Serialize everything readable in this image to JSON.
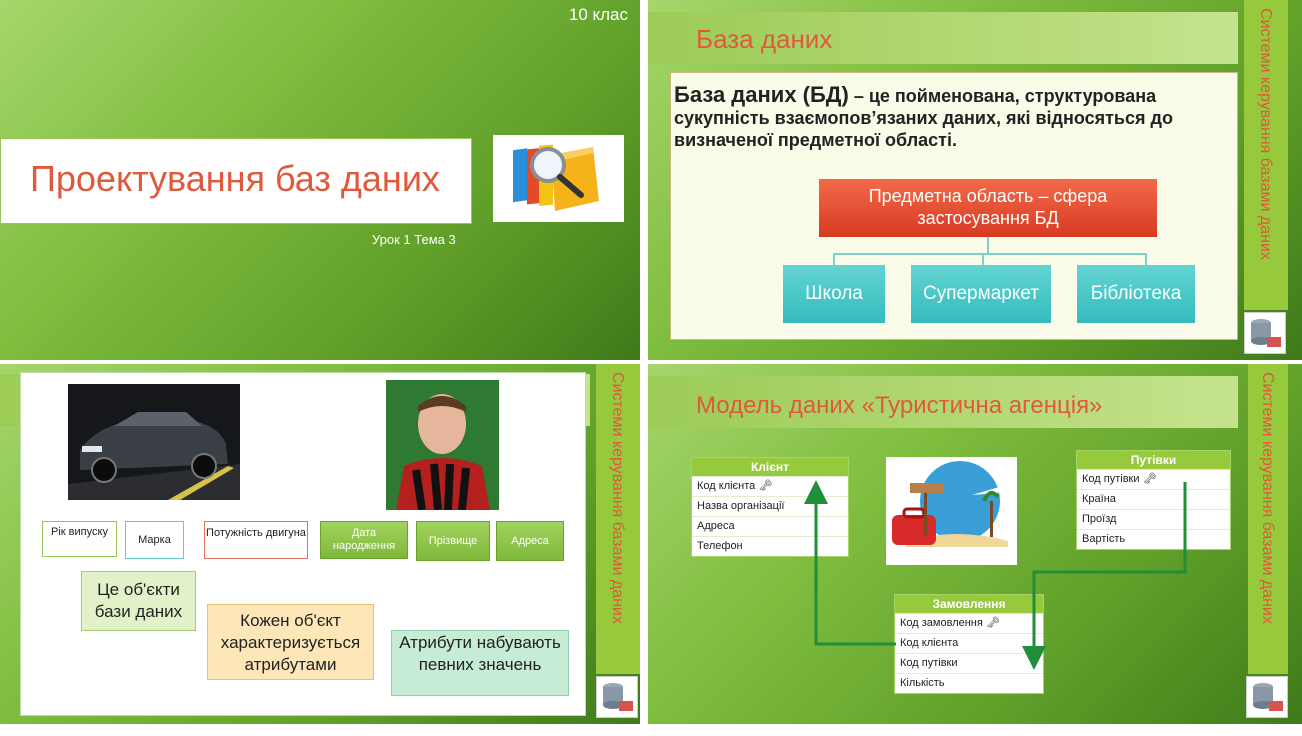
{
  "slide1": {
    "grade": "10 клас",
    "title": "Проектування баз даних",
    "lesson": "Урок 1 Тема 3",
    "image_icon": "folder-magnifier-icon"
  },
  "sidebar_text": "Системи керування базами даних",
  "slide2": {
    "heading": "База даних",
    "definition_term": "База даних (БД)",
    "definition_rest": " – це пойменована, структурована сукупність взаємопов’язаних даних, які відносяться до визначеної предметної області.",
    "subject_area": "Предметна область – сфера застосування БД",
    "examples": [
      "Школа",
      "Супермаркет",
      "Бібліотека"
    ]
  },
  "slide3": {
    "attributes_car": [
      "Рік випуску",
      "Марка",
      "Потужність двигуна"
    ],
    "attributes_person": [
      "Дата народження",
      "Прізвище",
      "Адреса"
    ],
    "notes": [
      "Це об'єкти бази даних",
      "Кожен об'єкт характеризується атрибутами",
      "Атрибути набувають певних значень"
    ],
    "colors": {
      "note1": "#e2f2c8",
      "note2": "#fde6b8",
      "note3": "#c7ecd6"
    }
  },
  "slide4": {
    "heading": "Модель даних «Туристична агенція»",
    "tables": {
      "client": {
        "title": "Клієнт",
        "rows": [
          "Код клієнта",
          "Назва організації",
          "Адреса",
          "Телефон"
        ]
      },
      "trips": {
        "title": "Путівки",
        "rows": [
          "Код путівки",
          "Країна",
          "Проїзд",
          "Вартість"
        ]
      },
      "orders": {
        "title": "Замовлення",
        "rows": [
          "Код замовлення",
          "Код клієнта",
          "Код путівки",
          "Кількість"
        ]
      }
    },
    "key_icon": "key-icon",
    "image_icon": "travel-suitcase-icon"
  },
  "colors": {
    "accent": "#e0593c",
    "green": "#97c93d",
    "teal": "#3fc0c0"
  }
}
